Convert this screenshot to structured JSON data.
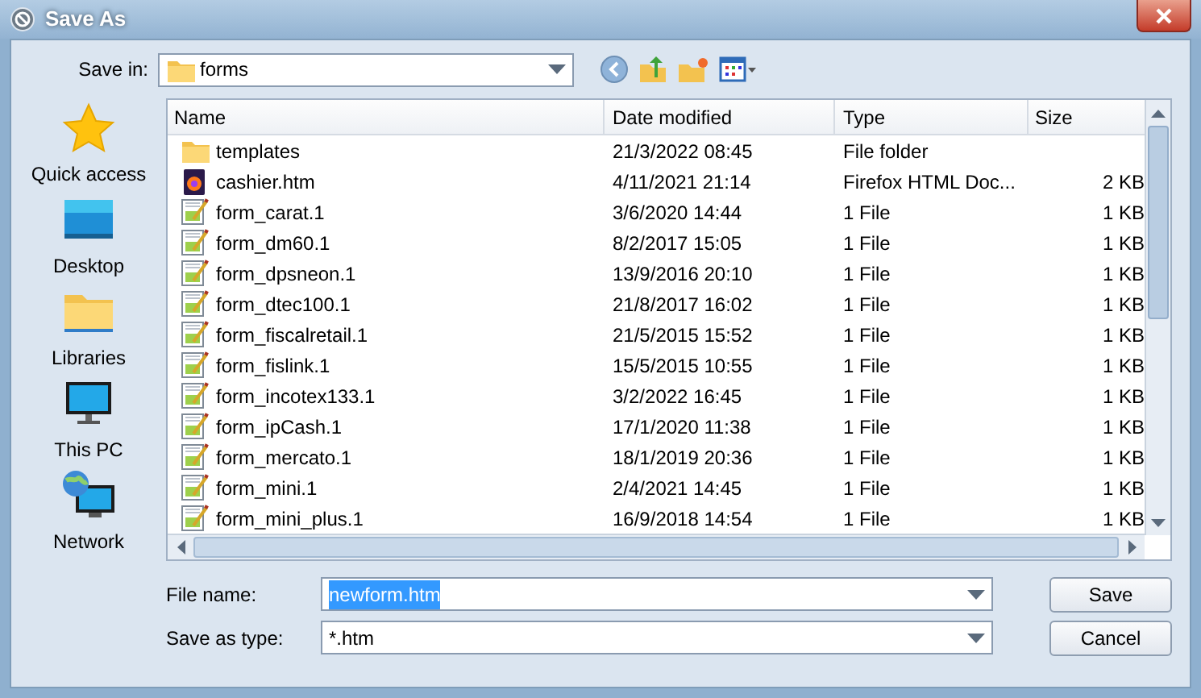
{
  "window": {
    "title": "Save As"
  },
  "save_in": {
    "label": "Save in:",
    "value": "forms"
  },
  "places": [
    {
      "kind": "star",
      "label": "Quick access"
    },
    {
      "kind": "desktop",
      "label": "Desktop"
    },
    {
      "kind": "libraries",
      "label": "Libraries"
    },
    {
      "kind": "pc",
      "label": "This PC"
    },
    {
      "kind": "network",
      "label": "Network"
    }
  ],
  "table": {
    "columns": [
      "Name",
      "Date modified",
      "Type",
      "Size"
    ],
    "rows": [
      {
        "kind": "folder",
        "name": "templates",
        "date": "21/3/2022 08:45",
        "type": "File folder"
      },
      {
        "kind": "firefox",
        "name": "cashier.htm",
        "date": "4/11/2021 21:14",
        "type": "Firefox HTML Doc...",
        "size": "2 KB"
      },
      {
        "kind": "file",
        "name": "form_carat.1",
        "date": "3/6/2020 14:44",
        "type": "1 File",
        "size": "1 KB"
      },
      {
        "kind": "file",
        "name": "form_dm60.1",
        "date": "8/2/2017 15:05",
        "type": "1 File",
        "size": "1 KB"
      },
      {
        "kind": "file",
        "name": "form_dpsneon.1",
        "date": "13/9/2016 20:10",
        "type": "1 File",
        "size": "1 KB"
      },
      {
        "kind": "file",
        "name": "form_dtec100.1",
        "date": "21/8/2017 16:02",
        "type": "1 File",
        "size": "1 KB"
      },
      {
        "kind": "file",
        "name": "form_fiscalretail.1",
        "date": "21/5/2015 15:52",
        "type": "1 File",
        "size": "1 KB"
      },
      {
        "kind": "file",
        "name": "form_fislink.1",
        "date": "15/5/2015 10:55",
        "type": "1 File",
        "size": "1 KB"
      },
      {
        "kind": "file",
        "name": "form_incotex133.1",
        "date": "3/2/2022 16:45",
        "type": "1 File",
        "size": "1 KB"
      },
      {
        "kind": "file",
        "name": "form_ipCash.1",
        "date": "17/1/2020 11:38",
        "type": "1 File",
        "size": "1 KB"
      },
      {
        "kind": "file",
        "name": "form_mercato.1",
        "date": "18/1/2019 20:36",
        "type": "1 File",
        "size": "1 KB"
      },
      {
        "kind": "file",
        "name": "form_mini.1",
        "date": "2/4/2021 14:45",
        "type": "1 File",
        "size": "1 KB"
      },
      {
        "kind": "file",
        "name": "form_mini_plus.1",
        "date": "16/9/2018 14:54",
        "type": "1 File",
        "size": "1 KB"
      }
    ]
  },
  "file_name": {
    "label": "File name:",
    "value": "newform.htm",
    "text_selected": true
  },
  "save_as_type": {
    "label": "Save as type:",
    "value": "*.htm"
  },
  "buttons": [
    "Save",
    "Cancel"
  ]
}
